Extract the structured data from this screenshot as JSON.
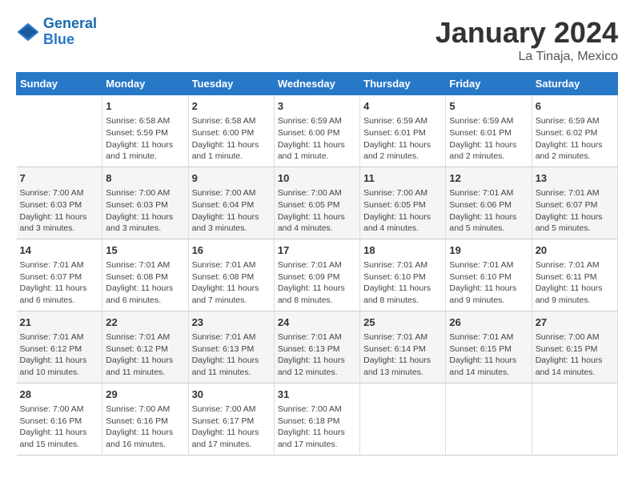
{
  "header": {
    "logo_line1": "General",
    "logo_line2": "Blue",
    "main_title": "January 2024",
    "subtitle": "La Tinaja, Mexico"
  },
  "columns": [
    "Sunday",
    "Monday",
    "Tuesday",
    "Wednesday",
    "Thursday",
    "Friday",
    "Saturday"
  ],
  "weeks": [
    [
      {
        "day": "",
        "info": ""
      },
      {
        "day": "1",
        "info": "Sunrise: 6:58 AM\nSunset: 5:59 PM\nDaylight: 11 hours\nand 1 minute."
      },
      {
        "day": "2",
        "info": "Sunrise: 6:58 AM\nSunset: 6:00 PM\nDaylight: 11 hours\nand 1 minute."
      },
      {
        "day": "3",
        "info": "Sunrise: 6:59 AM\nSunset: 6:00 PM\nDaylight: 11 hours\nand 1 minute."
      },
      {
        "day": "4",
        "info": "Sunrise: 6:59 AM\nSunset: 6:01 PM\nDaylight: 11 hours\nand 2 minutes."
      },
      {
        "day": "5",
        "info": "Sunrise: 6:59 AM\nSunset: 6:01 PM\nDaylight: 11 hours\nand 2 minutes."
      },
      {
        "day": "6",
        "info": "Sunrise: 6:59 AM\nSunset: 6:02 PM\nDaylight: 11 hours\nand 2 minutes."
      }
    ],
    [
      {
        "day": "7",
        "info": "Sunrise: 7:00 AM\nSunset: 6:03 PM\nDaylight: 11 hours\nand 3 minutes."
      },
      {
        "day": "8",
        "info": "Sunrise: 7:00 AM\nSunset: 6:03 PM\nDaylight: 11 hours\nand 3 minutes."
      },
      {
        "day": "9",
        "info": "Sunrise: 7:00 AM\nSunset: 6:04 PM\nDaylight: 11 hours\nand 3 minutes."
      },
      {
        "day": "10",
        "info": "Sunrise: 7:00 AM\nSunset: 6:05 PM\nDaylight: 11 hours\nand 4 minutes."
      },
      {
        "day": "11",
        "info": "Sunrise: 7:00 AM\nSunset: 6:05 PM\nDaylight: 11 hours\nand 4 minutes."
      },
      {
        "day": "12",
        "info": "Sunrise: 7:01 AM\nSunset: 6:06 PM\nDaylight: 11 hours\nand 5 minutes."
      },
      {
        "day": "13",
        "info": "Sunrise: 7:01 AM\nSunset: 6:07 PM\nDaylight: 11 hours\nand 5 minutes."
      }
    ],
    [
      {
        "day": "14",
        "info": "Sunrise: 7:01 AM\nSunset: 6:07 PM\nDaylight: 11 hours\nand 6 minutes."
      },
      {
        "day": "15",
        "info": "Sunrise: 7:01 AM\nSunset: 6:08 PM\nDaylight: 11 hours\nand 6 minutes."
      },
      {
        "day": "16",
        "info": "Sunrise: 7:01 AM\nSunset: 6:08 PM\nDaylight: 11 hours\nand 7 minutes."
      },
      {
        "day": "17",
        "info": "Sunrise: 7:01 AM\nSunset: 6:09 PM\nDaylight: 11 hours\nand 8 minutes."
      },
      {
        "day": "18",
        "info": "Sunrise: 7:01 AM\nSunset: 6:10 PM\nDaylight: 11 hours\nand 8 minutes."
      },
      {
        "day": "19",
        "info": "Sunrise: 7:01 AM\nSunset: 6:10 PM\nDaylight: 11 hours\nand 9 minutes."
      },
      {
        "day": "20",
        "info": "Sunrise: 7:01 AM\nSunset: 6:11 PM\nDaylight: 11 hours\nand 9 minutes."
      }
    ],
    [
      {
        "day": "21",
        "info": "Sunrise: 7:01 AM\nSunset: 6:12 PM\nDaylight: 11 hours\nand 10 minutes."
      },
      {
        "day": "22",
        "info": "Sunrise: 7:01 AM\nSunset: 6:12 PM\nDaylight: 11 hours\nand 11 minutes."
      },
      {
        "day": "23",
        "info": "Sunrise: 7:01 AM\nSunset: 6:13 PM\nDaylight: 11 hours\nand 11 minutes."
      },
      {
        "day": "24",
        "info": "Sunrise: 7:01 AM\nSunset: 6:13 PM\nDaylight: 11 hours\nand 12 minutes."
      },
      {
        "day": "25",
        "info": "Sunrise: 7:01 AM\nSunset: 6:14 PM\nDaylight: 11 hours\nand 13 minutes."
      },
      {
        "day": "26",
        "info": "Sunrise: 7:01 AM\nSunset: 6:15 PM\nDaylight: 11 hours\nand 14 minutes."
      },
      {
        "day": "27",
        "info": "Sunrise: 7:00 AM\nSunset: 6:15 PM\nDaylight: 11 hours\nand 14 minutes."
      }
    ],
    [
      {
        "day": "28",
        "info": "Sunrise: 7:00 AM\nSunset: 6:16 PM\nDaylight: 11 hours\nand 15 minutes."
      },
      {
        "day": "29",
        "info": "Sunrise: 7:00 AM\nSunset: 6:16 PM\nDaylight: 11 hours\nand 16 minutes."
      },
      {
        "day": "30",
        "info": "Sunrise: 7:00 AM\nSunset: 6:17 PM\nDaylight: 11 hours\nand 17 minutes."
      },
      {
        "day": "31",
        "info": "Sunrise: 7:00 AM\nSunset: 6:18 PM\nDaylight: 11 hours\nand 17 minutes."
      },
      {
        "day": "",
        "info": ""
      },
      {
        "day": "",
        "info": ""
      },
      {
        "day": "",
        "info": ""
      }
    ]
  ]
}
